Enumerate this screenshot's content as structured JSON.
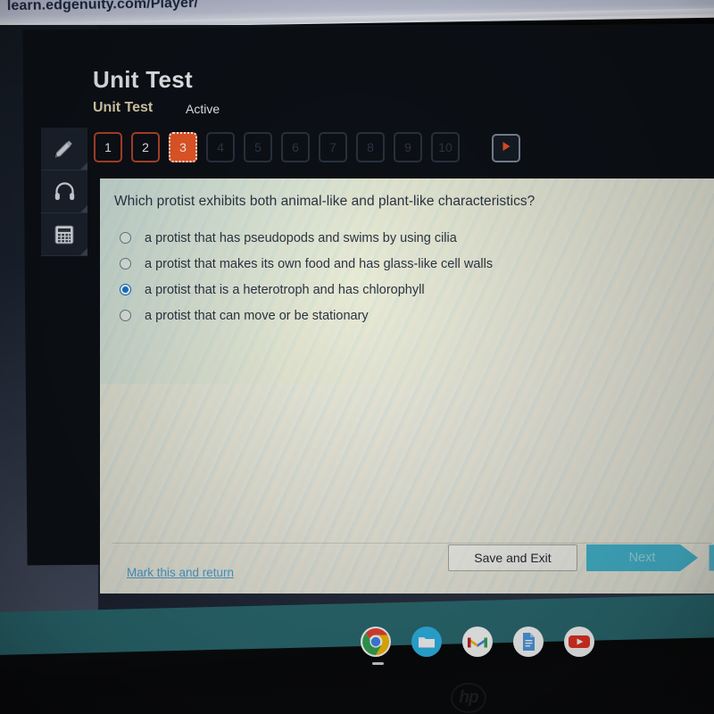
{
  "browser": {
    "url": "learn.edgenuity.com/Player/"
  },
  "header": {
    "title": "Unit Test",
    "subtitle": "Unit Test",
    "status": "Active"
  },
  "tools": [
    {
      "name": "highlighter-tool",
      "label": "Highlighter"
    },
    {
      "name": "audio-tool",
      "label": "Text to speech"
    },
    {
      "name": "calculator-tool",
      "label": "Calculator"
    }
  ],
  "question_tabs": {
    "items": [
      {
        "label": "1",
        "state": "answered"
      },
      {
        "label": "2",
        "state": "answered"
      },
      {
        "label": "3",
        "state": "active"
      },
      {
        "label": "4",
        "state": "dim"
      },
      {
        "label": "5",
        "state": "dim"
      },
      {
        "label": "6",
        "state": "dim"
      },
      {
        "label": "7",
        "state": "dim"
      },
      {
        "label": "8",
        "state": "dim"
      },
      {
        "label": "9",
        "state": "dim"
      },
      {
        "label": "10",
        "state": "dim"
      }
    ],
    "play_label": "▶"
  },
  "question": {
    "text": "Which protist exhibits both animal-like and plant-like characteristics?",
    "options": [
      {
        "label": "a protist that has pseudopods and swims by using cilia",
        "selected": false
      },
      {
        "label": "a protist that makes its own food and has glass-like cell walls",
        "selected": false
      },
      {
        "label": "a protist that is a heterotroph and has chlorophyll",
        "selected": true
      },
      {
        "label": "a protist that can move or be stationary",
        "selected": false
      }
    ]
  },
  "footer": {
    "mark_link": "Mark this and return",
    "save_label": "Save and Exit",
    "next_label": "Next"
  },
  "shelf": {
    "icons": [
      {
        "name": "chrome-icon",
        "label": "Chrome"
      },
      {
        "name": "files-icon",
        "label": "Files"
      },
      {
        "name": "gmail-icon",
        "label": "Gmail"
      },
      {
        "name": "docs-icon",
        "label": "Docs"
      },
      {
        "name": "youtube-icon",
        "label": "YouTube"
      }
    ]
  },
  "device": {
    "brand": "hp"
  },
  "colors": {
    "accent_orange": "#f05a28",
    "next_teal": "#46b9d2",
    "link_blue": "#4da3d8",
    "radio_blue": "#1579d4",
    "shelf_teal": "#2a6b72"
  }
}
